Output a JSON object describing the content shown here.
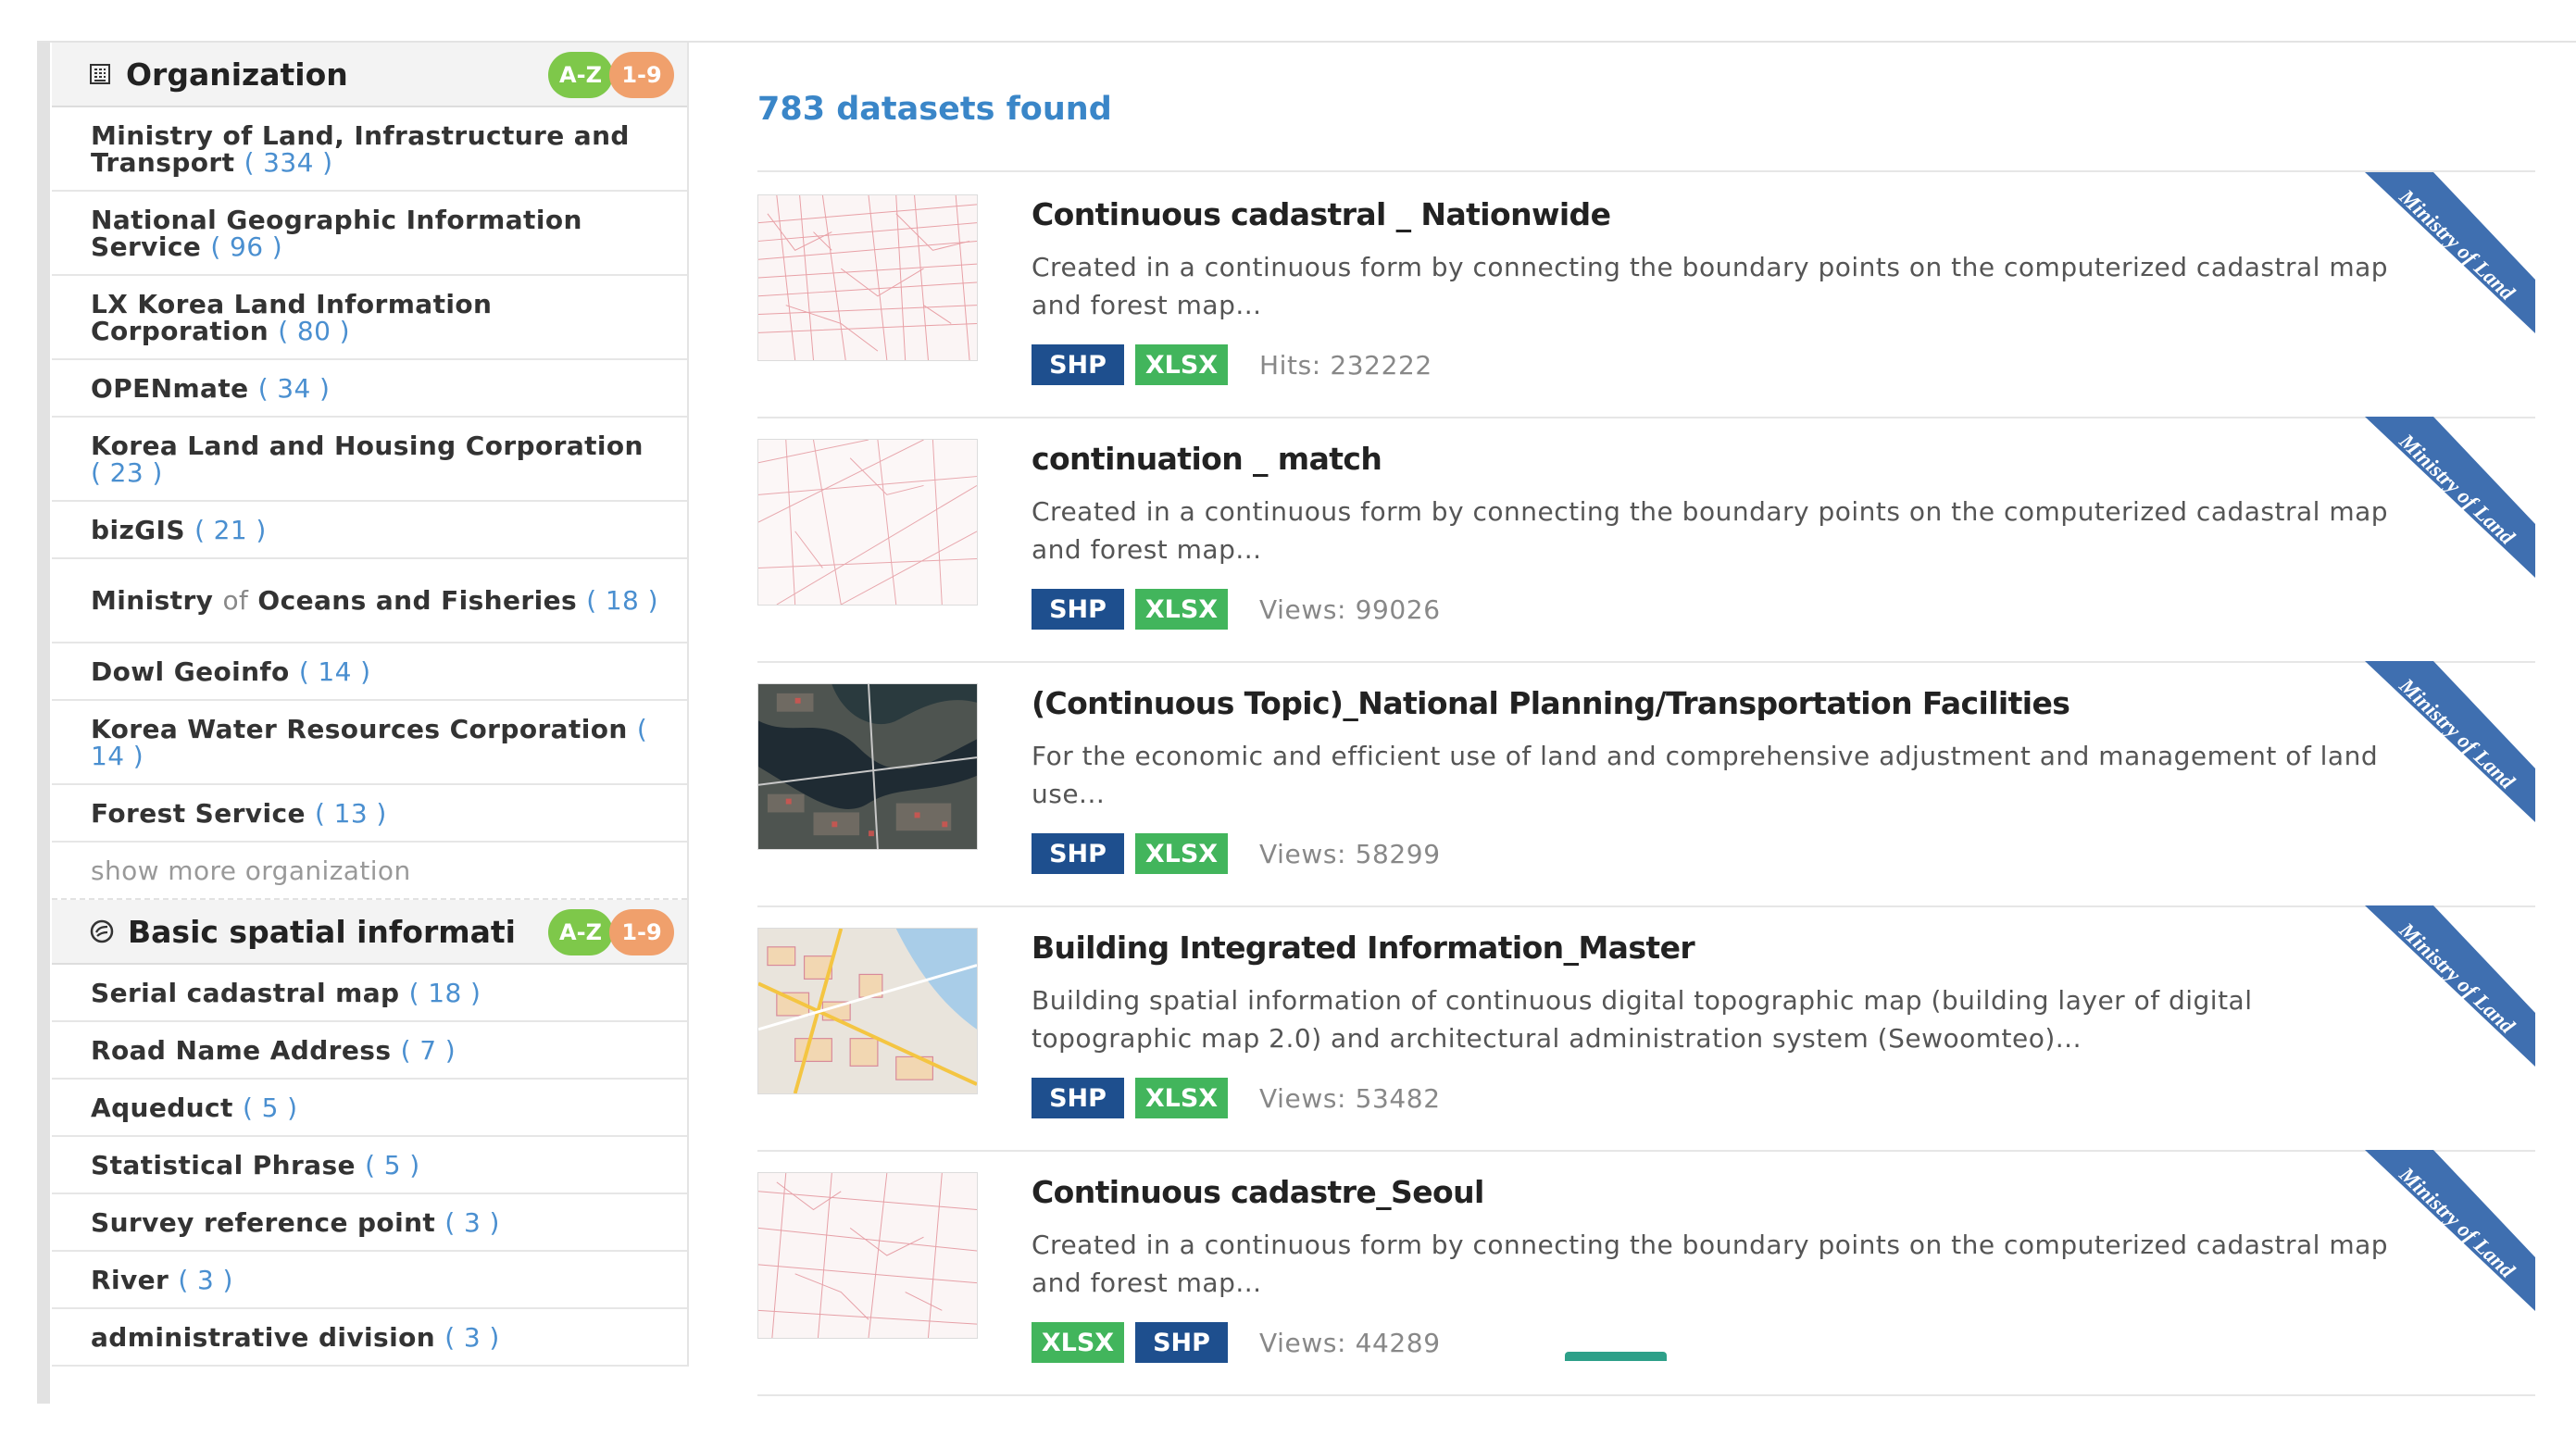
{
  "colors": {
    "link_blue": "#4a8fd0",
    "found_blue": "#3a86c8",
    "shp_blue": "#1e4f8e",
    "xlsx_green": "#42b55c",
    "az_green": "#7ec84a",
    "num_orange": "#f0a06c",
    "ribbon_blue": "#3f6fb0"
  },
  "sidebar": {
    "organization": {
      "title": "Organization",
      "icon": "building-icon",
      "badge_az": "A-Z",
      "badge_num": "1-9",
      "items": [
        {
          "name": "Ministry of Land, Infrastructure and Transport",
          "count": "( 334 )"
        },
        {
          "name": "National Geographic Information Service",
          "count": "( 96 )"
        },
        {
          "name": "LX Korea Land Information Corporation",
          "count": "( 80 )"
        },
        {
          "name": "OPENmate",
          "count": "( 34 )"
        },
        {
          "name": "Korea Land and Housing Corporation",
          "count": "( 23 )"
        },
        {
          "name": "bizGIS",
          "count": "( 21 )"
        },
        {
          "name_a": "Ministry",
          "name_b": "of",
          "name_c": "Oceans and Fisheries",
          "count": "( 18 )"
        },
        {
          "name": "Dowl Geoinfo",
          "count": "( 14 )"
        },
        {
          "name": "Korea Water Resources Corporation",
          "count": "( 14 )"
        },
        {
          "name": "Forest Service",
          "count": "( 13 )"
        }
      ],
      "show_more": "show more organization"
    },
    "basic_spatial": {
      "title": "Basic spatial informati",
      "icon": "circle-icon",
      "badge_az": "A-Z",
      "badge_num": "1-9",
      "items": [
        {
          "name": "Serial cadastral map",
          "count": "( 18 )"
        },
        {
          "name": "Road Name Address",
          "count": "( 7 )"
        },
        {
          "name": "Aqueduct",
          "count": "( 5 )"
        },
        {
          "name": "Statistical Phrase",
          "count": "( 5 )"
        },
        {
          "name": "Survey reference point",
          "count": "( 3 )"
        },
        {
          "name": "River",
          "count": "( 3 )"
        },
        {
          "name": "administrative division",
          "count": "( 3 )"
        }
      ]
    }
  },
  "results": {
    "found": "783 datasets found",
    "ribbon_label": "Ministry of Land",
    "datasets": [
      {
        "title": "Continuous cadastral _ Nationwide",
        "desc": "Created in a continuous form by connecting the boundary points on the computerized cadastral map and forest map...",
        "formats": [
          "SHP",
          "XLSX"
        ],
        "stat": "Hits: 232222",
        "thumb": "cadastral-map"
      },
      {
        "title": "continuation _ match",
        "desc": "Created in a continuous form by connecting the boundary points on the computerized cadastral map and forest map...",
        "formats": [
          "SHP",
          "XLSX"
        ],
        "stat": "Views: 99026",
        "thumb": "cadastral-map"
      },
      {
        "title": "(Continuous Topic)_National Planning/Transportation Facilities",
        "desc": "For the economic and efficient use of land and comprehensive adjustment and management of land use...",
        "formats": [
          "SHP",
          "XLSX"
        ],
        "stat": "Views: 58299",
        "thumb": "satellite-map"
      },
      {
        "title": "Building Integrated Information_Master",
        "desc": "Building spatial information of continuous digital topographic map (building layer of digital topographic map 2.0) and architectural administration system (Sewoomteo)...",
        "formats": [
          "SHP",
          "XLSX"
        ],
        "stat": "Views: 53482",
        "thumb": "building-map"
      },
      {
        "title": "Continuous cadastre_Seoul",
        "desc": "Created in a continuous form by connecting the boundary points on the computerized cadastral map and forest map...",
        "formats": [
          "XLSX",
          "SHP"
        ],
        "stat": "Views: 44289",
        "thumb": "cadastral-map"
      }
    ]
  }
}
